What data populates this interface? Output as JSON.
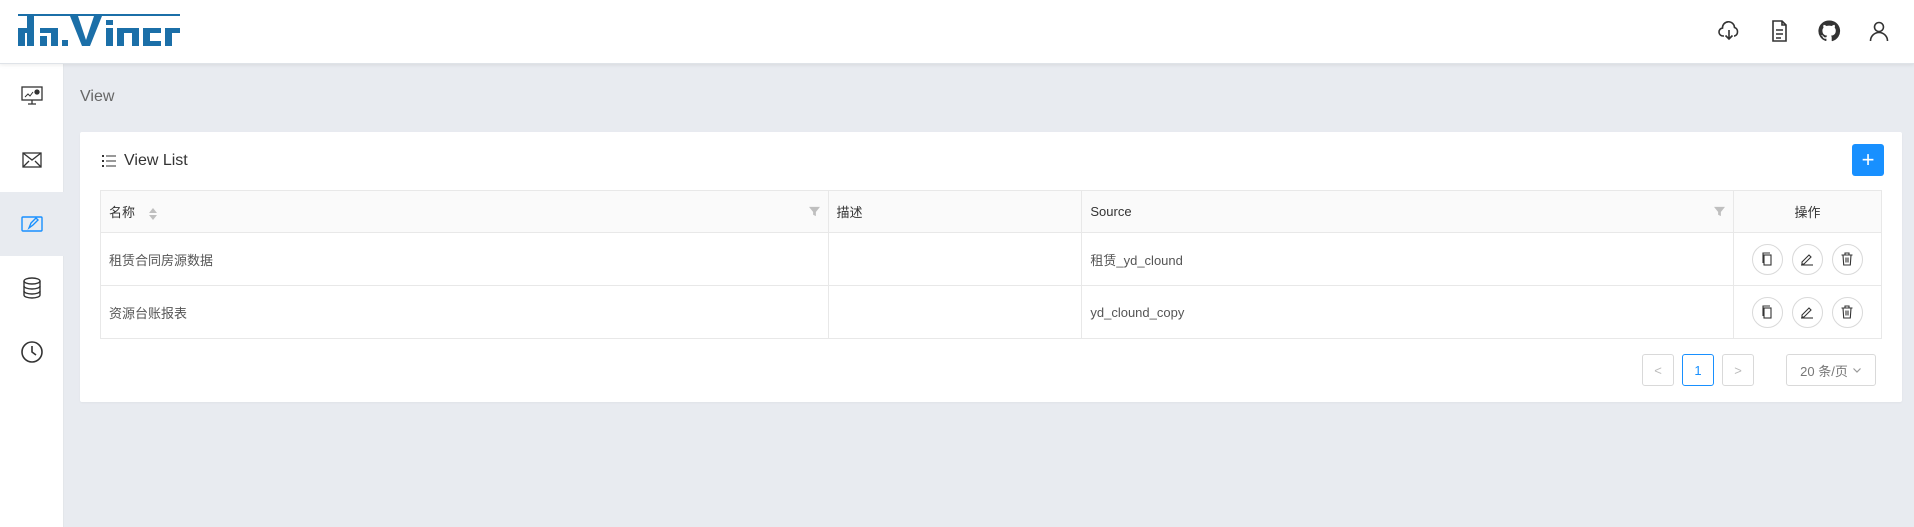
{
  "header": {
    "logo_text": "davinci",
    "actions": [
      {
        "name": "download-cloud-icon"
      },
      {
        "name": "document-icon"
      },
      {
        "name": "github-icon"
      },
      {
        "name": "user-icon"
      }
    ]
  },
  "sidebar": {
    "items": [
      {
        "name": "dashboard-monitor-icon",
        "active": false
      },
      {
        "name": "widget-icon",
        "active": false
      },
      {
        "name": "view-edit-icon",
        "active": true
      },
      {
        "name": "database-icon",
        "active": false
      },
      {
        "name": "schedule-clock-icon",
        "active": false
      }
    ]
  },
  "breadcrumb": "View",
  "card": {
    "title": "View List",
    "add_label": "+"
  },
  "table": {
    "headers": {
      "name": "名称",
      "description": "描述",
      "source": "Source",
      "actions": "操作"
    },
    "rows": [
      {
        "name": "租赁合同房源数据",
        "description": "",
        "source": "租赁_yd_clound"
      },
      {
        "name": "资源台账报表",
        "description": "",
        "source": "yd_clound_copy"
      }
    ]
  },
  "pagination": {
    "prev": "<",
    "current_page": "1",
    "next": ">",
    "page_size": "20 条/页"
  },
  "colors": {
    "accent": "#1890ff",
    "background": "#e8ebf0",
    "logo": "#1b6fa8"
  }
}
